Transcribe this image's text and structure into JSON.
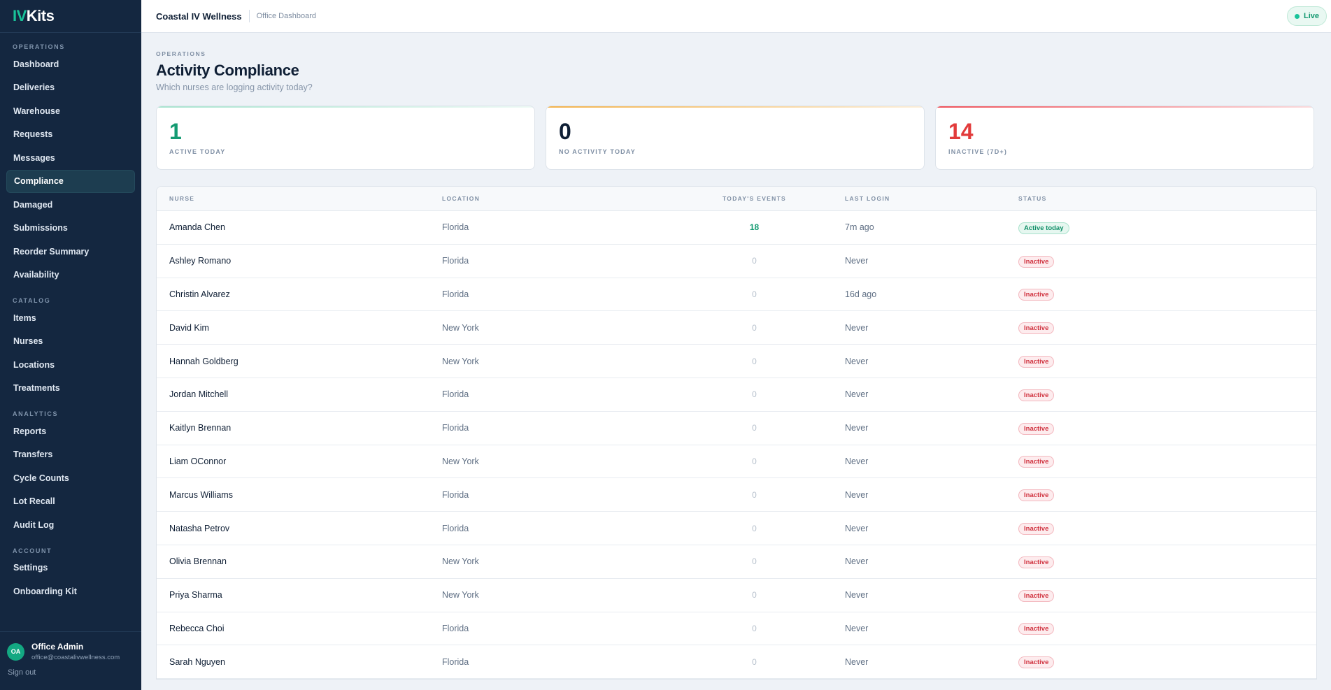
{
  "brand": {
    "logo_iv": "IV",
    "logo_kits": "Kits",
    "accent": "#19c39a"
  },
  "topbar": {
    "org_name": "Coastal IV Wellness",
    "crumb": "Office Dashboard",
    "live_label": "Live"
  },
  "sidebar": {
    "sections": [
      {
        "label": "OPERATIONS",
        "items": [
          "Dashboard",
          "Deliveries",
          "Warehouse",
          "Requests",
          "Messages",
          "Compliance",
          "Damaged",
          "Submissions",
          "Reorder Summary",
          "Availability"
        ]
      },
      {
        "label": "CATALOG",
        "items": [
          "Items",
          "Nurses",
          "Locations",
          "Treatments"
        ]
      },
      {
        "label": "ANALYTICS",
        "items": [
          "Reports",
          "Transfers",
          "Cycle Counts",
          "Lot Recall",
          "Audit Log"
        ]
      },
      {
        "label": "ACCOUNT",
        "items": [
          "Settings",
          "Onboarding Kit"
        ]
      }
    ],
    "active_item": "Compliance",
    "user": {
      "initials": "OA",
      "name": "Office Admin",
      "email": "office@coastalivwellness.com",
      "signout": "Sign out"
    }
  },
  "page": {
    "eyebrow": "OPERATIONS",
    "title": "Activity Compliance",
    "subtitle": "Which nurses are logging activity today?"
  },
  "stats": [
    {
      "value": "1",
      "label": "ACTIVE TODAY",
      "color": "#149b72",
      "accent": "#a8e3cf"
    },
    {
      "value": "0",
      "label": "NO ACTIVITY TODAY",
      "color": "#0f1f35",
      "accent": "#f3b24a"
    },
    {
      "value": "14",
      "label": "INACTIVE (7D+)",
      "color": "#e23b3b",
      "accent": "#ef4f57"
    }
  ],
  "table": {
    "headers": [
      "NURSE",
      "LOCATION",
      "TODAY'S EVENTS",
      "LAST LOGIN",
      "STATUS"
    ],
    "rows": [
      {
        "nurse": "Amanda Chen",
        "location": "Florida",
        "events": "18",
        "last_login": "7m ago",
        "status": "Active today"
      },
      {
        "nurse": "Ashley Romano",
        "location": "Florida",
        "events": "0",
        "last_login": "Never",
        "status": "Inactive"
      },
      {
        "nurse": "Christin Alvarez",
        "location": "Florida",
        "events": "0",
        "last_login": "16d ago",
        "status": "Inactive"
      },
      {
        "nurse": "David Kim",
        "location": "New York",
        "events": "0",
        "last_login": "Never",
        "status": "Inactive"
      },
      {
        "nurse": "Hannah Goldberg",
        "location": "New York",
        "events": "0",
        "last_login": "Never",
        "status": "Inactive"
      },
      {
        "nurse": "Jordan Mitchell",
        "location": "Florida",
        "events": "0",
        "last_login": "Never",
        "status": "Inactive"
      },
      {
        "nurse": "Kaitlyn Brennan",
        "location": "Florida",
        "events": "0",
        "last_login": "Never",
        "status": "Inactive"
      },
      {
        "nurse": "Liam OConnor",
        "location": "New York",
        "events": "0",
        "last_login": "Never",
        "status": "Inactive"
      },
      {
        "nurse": "Marcus Williams",
        "location": "Florida",
        "events": "0",
        "last_login": "Never",
        "status": "Inactive"
      },
      {
        "nurse": "Natasha Petrov",
        "location": "Florida",
        "events": "0",
        "last_login": "Never",
        "status": "Inactive"
      },
      {
        "nurse": "Olivia Brennan",
        "location": "New York",
        "events": "0",
        "last_login": "Never",
        "status": "Inactive"
      },
      {
        "nurse": "Priya Sharma",
        "location": "New York",
        "events": "0",
        "last_login": "Never",
        "status": "Inactive"
      },
      {
        "nurse": "Rebecca Choi",
        "location": "Florida",
        "events": "0",
        "last_login": "Never",
        "status": "Inactive"
      },
      {
        "nurse": "Sarah Nguyen",
        "location": "Florida",
        "events": "0",
        "last_login": "Never",
        "status": "Inactive"
      }
    ]
  }
}
